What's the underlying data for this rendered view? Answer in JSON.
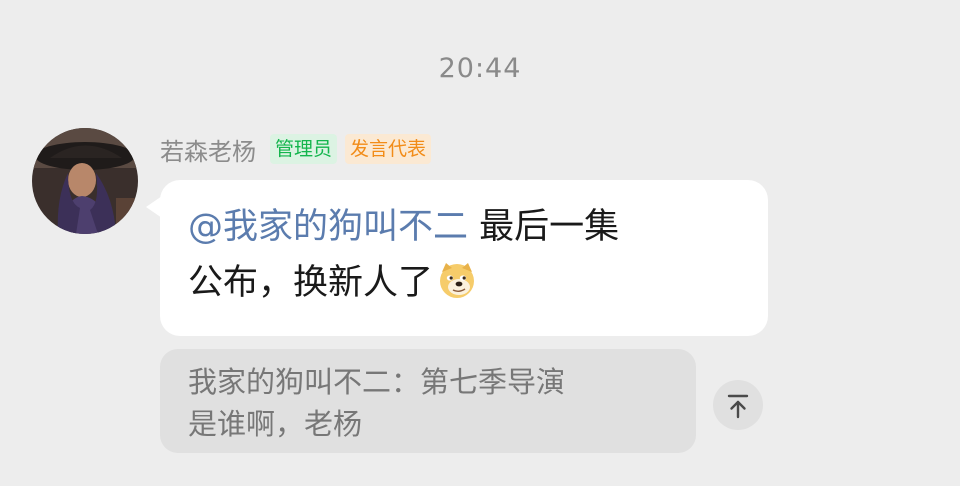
{
  "chat": {
    "timestamp": "20:44",
    "message": {
      "sender": {
        "name": "若森老杨",
        "badges": [
          {
            "label": "管理员",
            "color": "#14b54d"
          },
          {
            "label": "发言代表",
            "color": "#f28c18"
          }
        ]
      },
      "mention": "@我家的狗叫不二",
      "line1_text": " 最后一集",
      "line2_text": "公布，换新人了",
      "emoji": "doge-emoji"
    },
    "quote": {
      "line1": "我家的狗叫不二：第七季导演",
      "line2": "是谁啊，老杨"
    },
    "scroll_top_icon": "arrow-up-to-top-icon"
  },
  "colors": {
    "background": "#ededed",
    "bubble": "#ffffff",
    "mention": "#5b7cae",
    "quote_bg": "#e0e0e0"
  }
}
